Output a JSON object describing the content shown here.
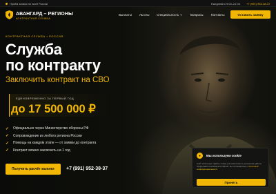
{
  "topbar": {
    "notice": "Приём заявок по всей России",
    "hours": "Ежедневно 9:00–21:00",
    "phone": "+7 (991) 952-38-37"
  },
  "header": {
    "brand_name": "АВАНГАРД – РЕГИОНЫ",
    "brand_sub": "КОНТРАКТНАЯ СЛУЖБА",
    "nav": [
      "Выплаты",
      "Льготы",
      "Специальность",
      "Вопросы",
      "Контакты"
    ],
    "cta_label": "Оставить заявку"
  },
  "hero": {
    "eyebrow": "КОНТРАКТНАЯ СЛУЖБА • РОССИЯ",
    "title_line1": "Служба",
    "title_line2": "по контракту",
    "subtitle": "Заключить контракт на СВО",
    "sum_label": "ЕДИНОВРЕМЕННО ЗА ПЕРВЫЙ ГОД",
    "sum_value": "до 17 500 000 ₽",
    "benefits": [
      "Официально через Министерство обороны РФ",
      "Сопровождение из любого региона России",
      "Помощь на каждом этапе — от заявки до контракта",
      "Контракт можно заключить на 1 год"
    ],
    "cta_label": "Получить расчёт выплат",
    "phone": "+7 (991) 952-38-37"
  },
  "cookie": {
    "title": "Мы используем cookie",
    "text_before": "Сайт использует файлы cookie для аналитики и улучшения работы. Продолжая пользоваться сайтом, вы соглашаетесь с ",
    "text_link": "политикой конфиденциальности",
    "button_label": "Принять"
  },
  "colors": {
    "accent": "#f2b705",
    "background": "#0c0d0a"
  }
}
